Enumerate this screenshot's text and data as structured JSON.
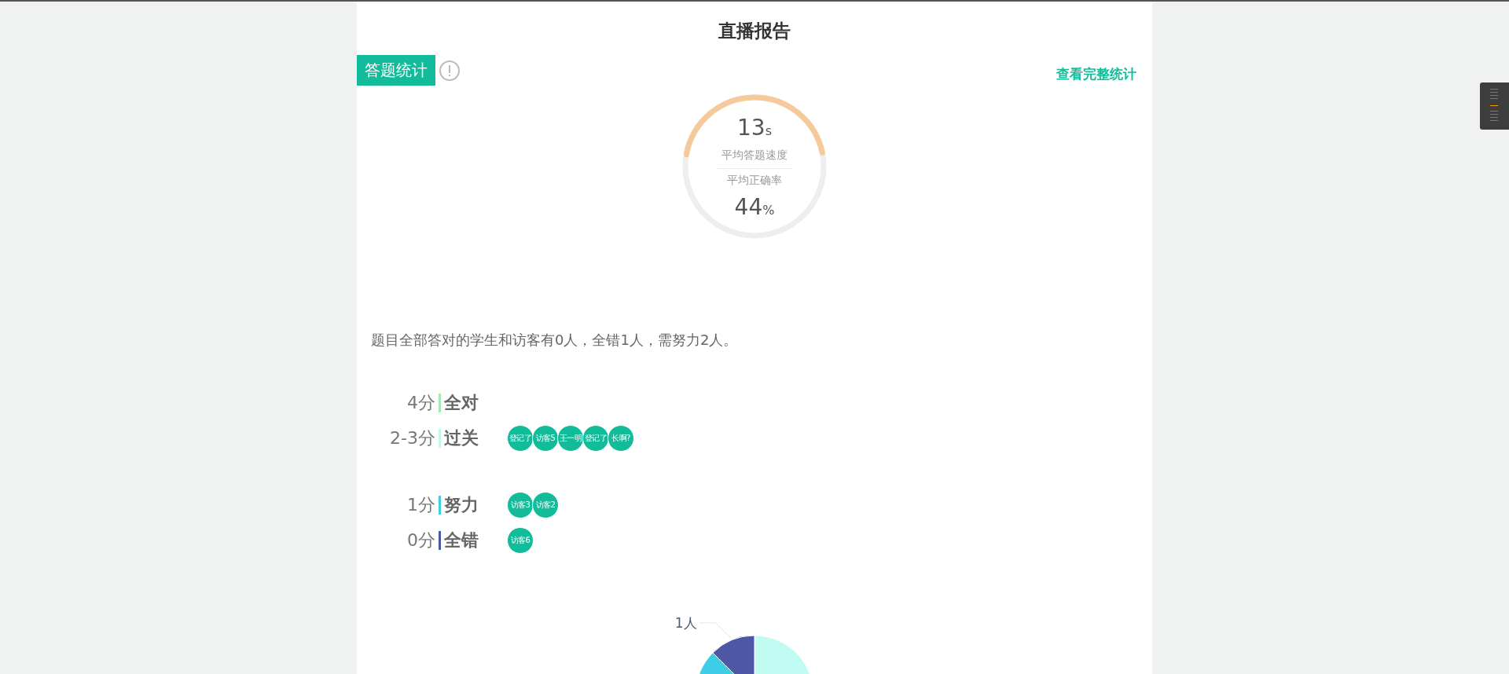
{
  "page": {
    "title": "直播报告"
  },
  "section": {
    "tag": "答题统计",
    "link": "查看完整统计"
  },
  "gauge": {
    "speed_value": "13",
    "speed_unit": "s",
    "speed_label": "平均答题速度",
    "accuracy_label": "平均正确率",
    "accuracy_value": "44",
    "accuracy_unit": "%"
  },
  "summary": "题目全部答对的学生和访客有0人，全错1人，需努力2人。",
  "score_groups": [
    {
      "score": "4分",
      "name": "全对",
      "color": "#a8e8b4"
    },
    {
      "score": "2-3分",
      "name": "过关",
      "color": "#c0f7f0",
      "people": [
        "登记了",
        "访客5",
        "王一明",
        "登记了",
        "长啊?"
      ]
    },
    {
      "score": "1分",
      "name": "努力",
      "color": "#3ecde6",
      "people": [
        "访客3",
        "访客2"
      ]
    },
    {
      "score": "0分",
      "name": "全错",
      "color": "#4e56a6",
      "people": [
        "访客6"
      ]
    }
  ],
  "pie": {
    "label": "1人"
  }
}
